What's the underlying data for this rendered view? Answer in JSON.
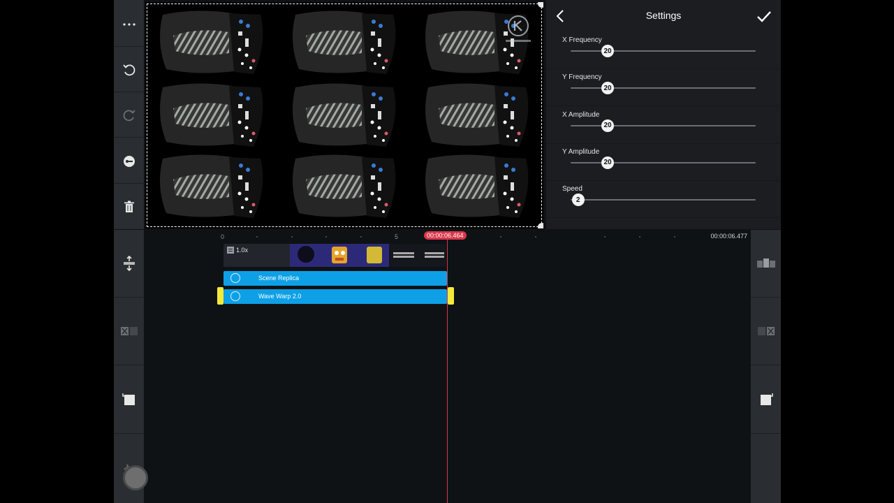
{
  "settings": {
    "title": "Settings",
    "params": [
      {
        "label": "X Frequency",
        "value": "20",
        "fraction": 0.2
      },
      {
        "label": "Y Frequency",
        "value": "20",
        "fraction": 0.2
      },
      {
        "label": "X Amplitude",
        "value": "20",
        "fraction": 0.2
      },
      {
        "label": "Y Amplitude",
        "value": "20",
        "fraction": 0.2
      },
      {
        "label": "Speed",
        "value": "2",
        "fraction": 0.04
      }
    ]
  },
  "timeline": {
    "ruler": {
      "start": "0",
      "five": "5"
    },
    "playhead_time": "00:00:06.464",
    "end_time": "00:00:06.477",
    "video_speed": "1.0x",
    "layers": [
      {
        "label": "Scene Replica"
      },
      {
        "label": "Wave Warp 2.0"
      }
    ]
  },
  "colors": {
    "accent": "#0ea0e6",
    "playhead": "#d9364a",
    "selection": "#f5e93a"
  },
  "icons": {
    "more": "more-icon",
    "undo": "undo-icon",
    "redo": "redo-icon",
    "keyframe": "keyframe-icon",
    "delete": "trash-icon"
  }
}
